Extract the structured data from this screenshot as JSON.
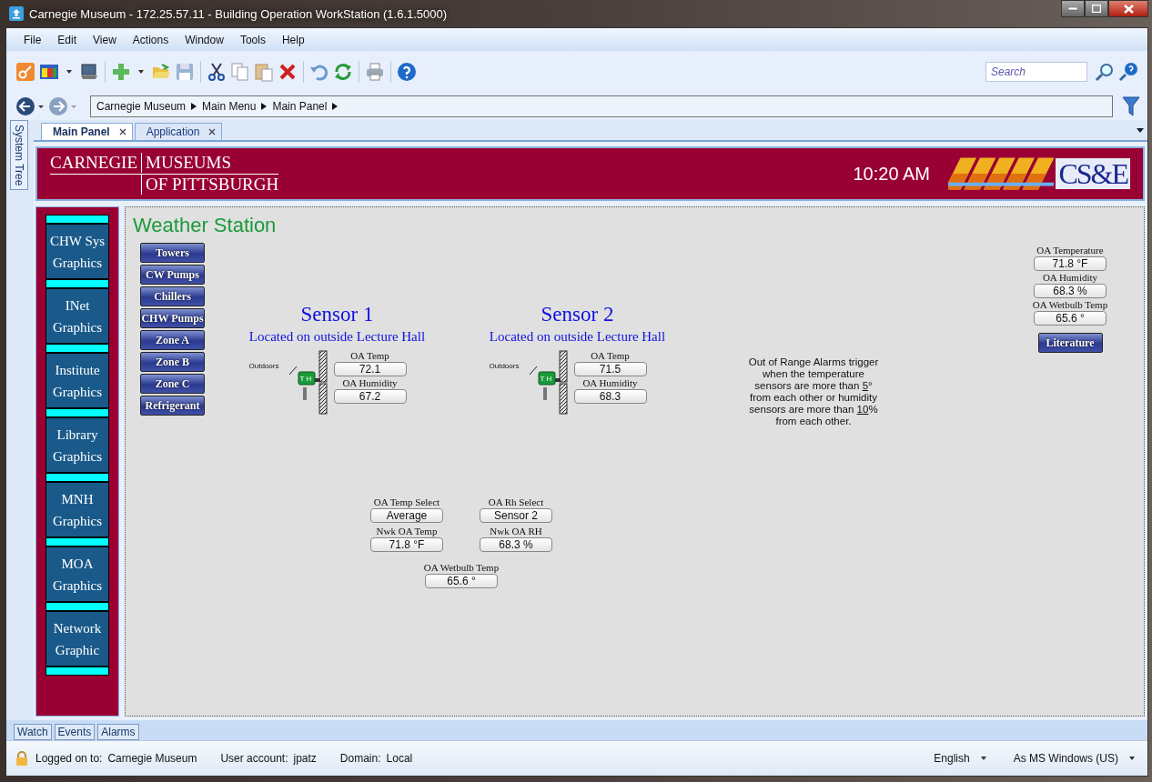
{
  "window": {
    "title": "Carnegie Museum - 172.25.57.11 - Building Operation WorkStation (1.6.1.5000)"
  },
  "menu": [
    "File",
    "Edit",
    "View",
    "Actions",
    "Window",
    "Tools",
    "Help"
  ],
  "search": {
    "placeholder": "Search"
  },
  "breadcrumb": [
    "Carnegie Museum",
    "Main Menu",
    "Main Panel"
  ],
  "tabs": [
    {
      "label": "Main Panel",
      "selected": true
    },
    {
      "label": "Application",
      "selected": false
    }
  ],
  "side_tab": "System Tree",
  "banner": {
    "logo_left": "CARNEGIE",
    "logo_right": "MUSEUMS",
    "logo_bottom": "OF PITTSBURGH",
    "time": "10:20 AM",
    "brand": "CS&E"
  },
  "nav": [
    "CHW Sys Graphics",
    "INet Graphics",
    "Institute Graphics",
    "Library Graphics",
    "MNH Graphics",
    "MOA Graphics",
    "Network Graphic"
  ],
  "page_title": "Weather Station",
  "buttons": [
    "Towers",
    "CW Pumps",
    "Chillers",
    "CHW Pumps",
    "Zone A",
    "Zone B",
    "Zone C",
    "Refrigerant"
  ],
  "sensors": [
    {
      "title": "Sensor 1",
      "location": "Located on outside Lecture Hall",
      "outdoors": "Outdoors",
      "probe": "T H",
      "fields": [
        {
          "label": "OA Temp",
          "value": "72.1"
        },
        {
          "label": "OA Humidity",
          "value": "67.2"
        }
      ]
    },
    {
      "title": "Sensor 2",
      "location": "Located on outside Lecture Hall",
      "outdoors": "Outdoors",
      "probe": "T H",
      "fields": [
        {
          "label": "OA Temp",
          "value": "71.5"
        },
        {
          "label": "OA Humidity",
          "value": "68.3"
        }
      ]
    }
  ],
  "note": [
    {
      "text": "Out of Range Alarms trigger when the temperature sensors are more than ",
      "underlined": false
    },
    {
      "text": " 5",
      "underlined": true
    },
    {
      "text": "° from each other or humidity sensors are more than ",
      "underlined": false
    },
    {
      "text": "10",
      "underlined": true
    },
    {
      "text": "% from each other.",
      "underlined": false
    }
  ],
  "summary": [
    {
      "label": "OA Temperature",
      "value": "71.8 °F"
    },
    {
      "label": "OA Humidity",
      "value": "68.3 %"
    },
    {
      "label": "OA Wetbulb Temp",
      "value": "65.6 °"
    }
  ],
  "literature_button": "Literature",
  "selects": [
    {
      "label": "OA Temp Select",
      "value": "Average"
    },
    {
      "label": "OA Rh Select",
      "value": "Sensor 2"
    },
    {
      "label": "Nwk OA Temp",
      "value": "71.8 °F"
    },
    {
      "label": "Nwk OA RH",
      "value": "68.3 %"
    },
    {
      "label": "OA Wetbulb Temp",
      "value": "65.6 °"
    }
  ],
  "bottom_tabs": [
    "Watch",
    "Events",
    "Alarms"
  ],
  "status_bar": {
    "logged_on_label": "Logged on to:",
    "logged_on": "Carnegie Museum",
    "account_label": "User account:",
    "account": "jpatz",
    "domain_label": "Domain:",
    "domain": "Local",
    "language": "English",
    "format": "As MS Windows (US)"
  }
}
